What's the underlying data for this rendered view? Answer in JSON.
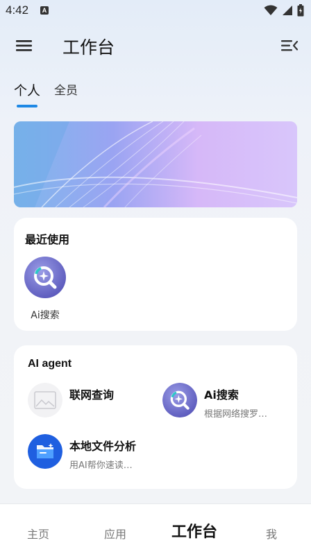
{
  "status_bar": {
    "time": "4:42",
    "notification_badge": "A"
  },
  "header": {
    "title": "工作台",
    "menu_icon": "hamburger-menu-icon",
    "collapse_icon": "menu-collapse-icon"
  },
  "tabs": [
    {
      "label": "个人",
      "active": true
    },
    {
      "label": "全员",
      "active": false
    }
  ],
  "recent": {
    "title": "最近使用",
    "items": [
      {
        "label": "Ai搜索",
        "icon": "ai-search-icon"
      }
    ]
  },
  "agents": {
    "title": "AI agent",
    "items": [
      {
        "name": "联网查询",
        "description": "",
        "icon": "image-placeholder-icon"
      },
      {
        "name": "Ai搜索",
        "description": "根据网络搜罗…",
        "icon": "ai-search-icon"
      },
      {
        "name": "本地文件分析",
        "description": "用AI帮你速读…",
        "icon": "folder-icon"
      }
    ]
  },
  "bottom_nav": [
    {
      "label": "主页",
      "active": false
    },
    {
      "label": "应用",
      "active": false
    },
    {
      "label": "工作台",
      "active": true
    },
    {
      "label": "我",
      "active": false
    }
  ],
  "colors": {
    "accent": "#1e88e5",
    "folder_blue": "#1f5fe0"
  }
}
